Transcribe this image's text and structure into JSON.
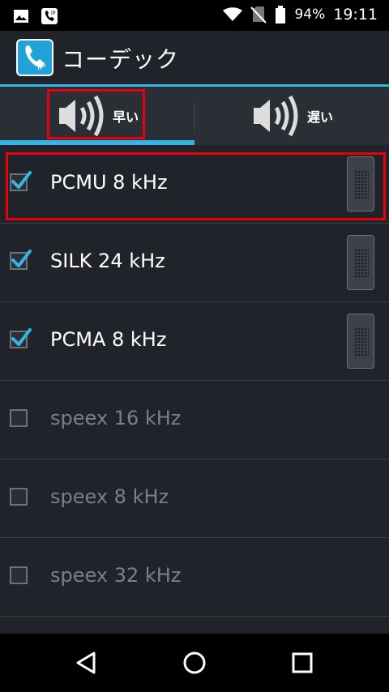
{
  "status_bar": {
    "battery": "94%",
    "time": "19:11",
    "icons": [
      "image-icon",
      "voip-phone-icon",
      "wifi-icon",
      "no-sim-icon",
      "battery-icon"
    ]
  },
  "action_bar": {
    "title": "コーデック",
    "app_icon_text": "IP"
  },
  "tabs": [
    {
      "label": "早い",
      "selected": true
    },
    {
      "label": "遅い",
      "selected": false
    }
  ],
  "codecs": [
    {
      "label": "PCMU 8 kHz",
      "checked": true
    },
    {
      "label": "SILK 24 kHz",
      "checked": true
    },
    {
      "label": "PCMA 8 kHz",
      "checked": true
    },
    {
      "label": "speex 16 kHz",
      "checked": false
    },
    {
      "label": "speex 8 kHz",
      "checked": false
    },
    {
      "label": "speex 32 kHz",
      "checked": false
    }
  ],
  "colors": {
    "accent": "#33b5e5",
    "highlight": "#e8000c",
    "background": "#202329"
  }
}
